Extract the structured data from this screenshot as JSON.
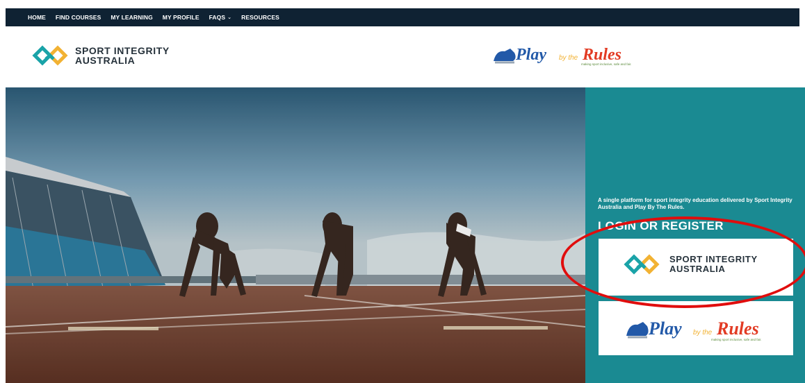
{
  "nav": {
    "items": [
      {
        "label": "HOME"
      },
      {
        "label": "FIND COURSES"
      },
      {
        "label": "MY LEARNING"
      },
      {
        "label": "MY PROFILE"
      },
      {
        "label": "FAQS"
      },
      {
        "label": "RESOURCES"
      }
    ],
    "faqs_chevron": "chevron-down-icon"
  },
  "header": {
    "sia_logo": {
      "line1": "SPORT INTEGRITY",
      "line2": "AUSTRALIA"
    },
    "pbr_logo": {
      "play": "Play",
      "by_the": "by the",
      "rules": "Rules",
      "tagline": "making sport inclusive, safe and fair."
    }
  },
  "sidebar": {
    "tagline": "A single platform for sport integrity education delivered by Sport Integrity Australia and Play By The Rules.",
    "heading": "LOGIN OR REGISTER",
    "card1": {
      "line1": "SPORT INTEGRITY",
      "line2": "AUSTRALIA"
    },
    "card2": {
      "play": "Play",
      "by_the": "by the",
      "rules": "Rules",
      "tagline": "making sport inclusive, safe and fair."
    }
  },
  "colors": {
    "nav_bg": "#0f2233",
    "sidebar_teal": "#1a8a92",
    "sia_teal": "#1aa3a8",
    "sia_gold": "#f2b233",
    "pbr_blue": "#2259a8",
    "pbr_red": "#e23b24",
    "annotation_red": "#e00d0d"
  }
}
